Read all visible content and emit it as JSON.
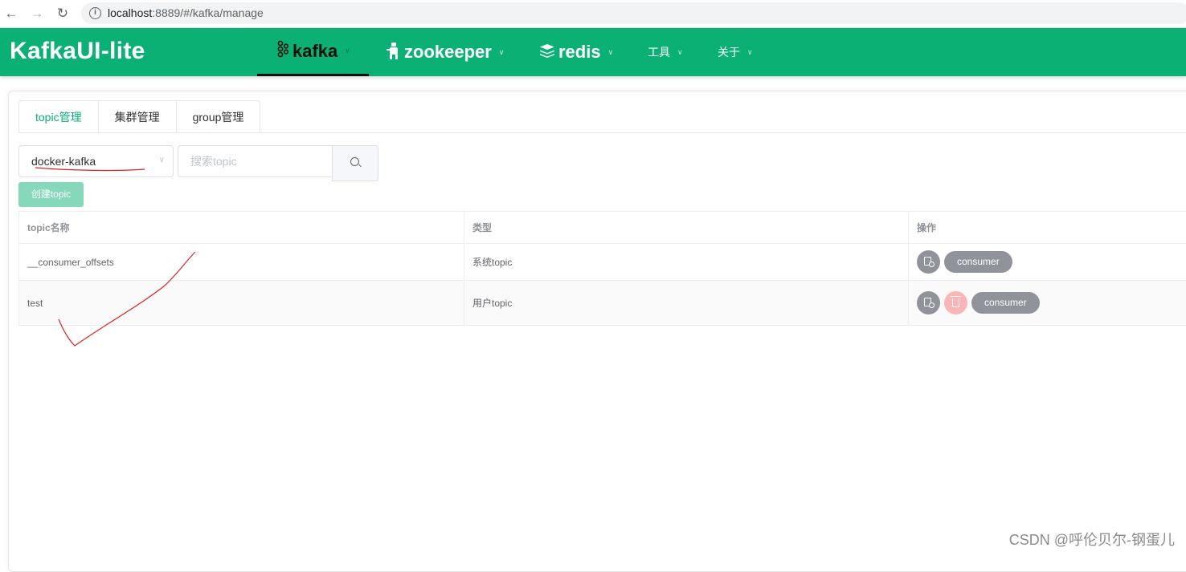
{
  "browser": {
    "url_host": "localhost",
    "url_rest": ":8889/#/kafka/manage"
  },
  "header": {
    "brand": "KafkaUI-lite",
    "menu": [
      {
        "label": "kafka",
        "icon": "kafka-icon",
        "active": true
      },
      {
        "label": "zookeeper",
        "icon": "zookeeper-icon",
        "active": false
      },
      {
        "label": "redis",
        "icon": "redis-icon",
        "active": false
      },
      {
        "label": "工具",
        "active": false
      },
      {
        "label": "关于",
        "active": false
      }
    ],
    "color": "#0bb174"
  },
  "tabs": [
    "topic管理",
    "集群管理",
    "group管理"
  ],
  "toolbar": {
    "cluster_value": "docker-kafka",
    "search_placeholder": "搜索topic",
    "create_label": "创建topic"
  },
  "table": {
    "columns": [
      "topic名称",
      "类型",
      "操作"
    ],
    "rows": [
      {
        "name": "__consumer_offsets",
        "type": "系统topic",
        "consumer_label": "consumer"
      },
      {
        "name": "test",
        "type": "用户topic",
        "consumer_label": "consumer"
      }
    ]
  },
  "watermark": "CSDN @呼伦贝尔-钢蛋儿"
}
